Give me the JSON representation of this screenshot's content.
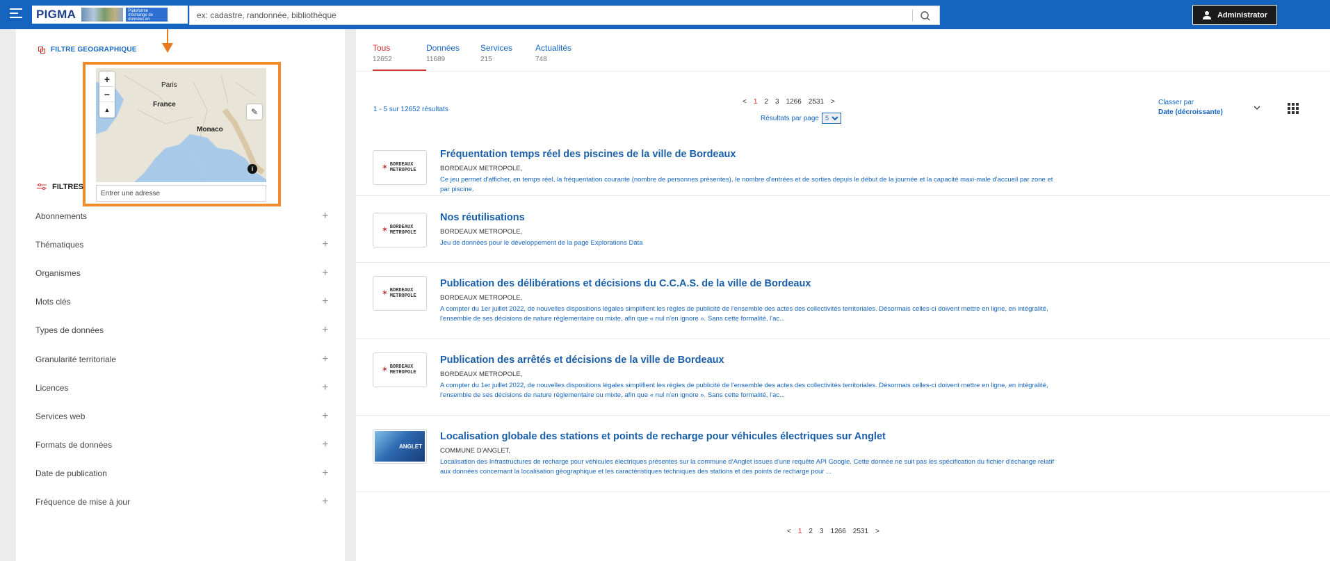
{
  "topbar": {
    "logo_text": "PIGMA",
    "logo_subtitle": "Plateforme d'échange de données en Nouvelle-Aquitaine",
    "search_placeholder": "ex: cadastre, randonnée, bibliothèque",
    "user_label": "Administrator",
    "accent_color": "#1565c0"
  },
  "geo_filter": {
    "title": "FILTRE GEOGRAPHIQUE",
    "map_labels": [
      "Paris",
      "France",
      "Monaco"
    ],
    "zoom_in": "+",
    "zoom_out": "−",
    "address_placeholder": "Entrer une adresse",
    "highlight_color": "#f08a2c"
  },
  "filters": {
    "title": "FILTRES",
    "items": [
      "Abonnements",
      "Thématiques",
      "Organismes",
      "Mots clés",
      "Types de données",
      "Granularité territoriale",
      "Licences",
      "Services web",
      "Formats de données",
      "Date de publication",
      "Fréquence de mise à jour"
    ]
  },
  "tabs": [
    {
      "label": "Tous",
      "count": "12652",
      "active": true
    },
    {
      "label": "Données",
      "count": "11689",
      "active": false
    },
    {
      "label": "Services",
      "count": "215",
      "active": false
    },
    {
      "label": "Actualités",
      "count": "748",
      "active": false
    }
  ],
  "results_summary": {
    "count_text": "1 - 5  sur 12652 résultats",
    "pages": [
      "1",
      "2",
      "3",
      "1266",
      "2531"
    ],
    "current_page": "1",
    "per_page_label": "Résultats par page",
    "per_page_value": "5",
    "sort_label": "Classer par",
    "sort_value": "Date (décroissante)"
  },
  "results": [
    {
      "title": "Fréquentation temps réel des piscines de la ville de Bordeaux",
      "org": "BORDEAUX METROPOLE,",
      "desc": "Ce jeu permet d'afficher, en temps réel, la fréquentation courante (nombre de personnes présentes), le nombre d'entrées et de sorties depuis le début de la journée et la capacité maxi-male d'accueil par zone et par piscine.",
      "logo": "BORDEAUX METROPOLE"
    },
    {
      "title": "Nos réutilisations",
      "org": "BORDEAUX METROPOLE,",
      "desc": "Jeu de données pour le développement de la page Explorations Data",
      "logo": "BORDEAUX METROPOLE"
    },
    {
      "title": "Publication des délibérations et décisions du C.C.A.S. de la ville de Bordeaux",
      "org": "BORDEAUX METROPOLE,",
      "desc": "A compter du 1er juillet 2022, de nouvelles dispositions légales simplifient les règles de publicité de l'ensemble des actes des collectivités territoriales. Désormais celles-ci doivent mettre en ligne, en intégralité, l'ensemble de ses décisions de nature réglementaire ou mixte, afin que « nul n'en ignore ». Sans cette formalité, l'ac...",
      "logo": "BORDEAUX METROPOLE"
    },
    {
      "title": "Publication des arrêtés et décisions de la ville de Bordeaux",
      "org": "BORDEAUX METROPOLE,",
      "desc": "A compter du 1er juillet 2022, de nouvelles dispositions légales simplifient les règles de publicité de l'ensemble des actes des collectivités territoriales. Désormais celles-ci doivent mettre en ligne, en intégralité, l'ensemble de ses décisions de nature réglementaire ou mixte, afin que « nul n'en ignore ». Sans cette formalité, l'ac...",
      "logo": "BORDEAUX METROPOLE"
    },
    {
      "title": "Localisation globale des stations et points de recharge pour véhicules électriques sur Anglet",
      "org": "COMMUNE D'ANGLET,",
      "desc": "Localisation des Infrastructures de recharge pour véhicules électriques présentes sur la commune d'Anglet issues d'une requête API Google. Cette donnée ne suit pas les spécification du fichier d'échange relatif aux données concernant la localisation géographique et les caractéristiques techniques des stations et des points de recharge pour ...",
      "logo": "ANGLET"
    }
  ]
}
